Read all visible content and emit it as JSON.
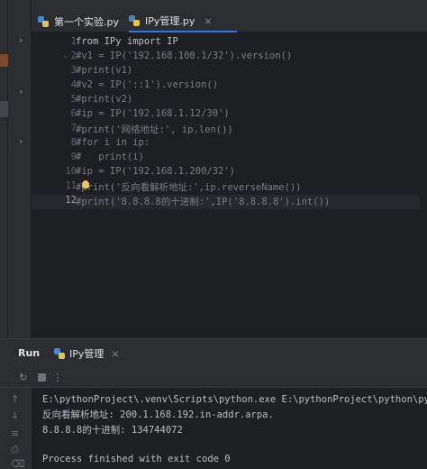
{
  "editor_tabs": [
    {
      "label": "第一个实验.py",
      "active": false
    },
    {
      "label": "IPy管理.py",
      "active": true
    }
  ],
  "tab_close_glyph": "×",
  "project_chevrons": [
    "›",
    "›",
    "›"
  ],
  "code": {
    "current_line": 12,
    "lines": [
      {
        "num": "1",
        "text": "from IPy import IP"
      },
      {
        "num": "2",
        "text": "#v1 = IP('192.168.100.1/32').version()"
      },
      {
        "num": "3",
        "text": "#print(v1)"
      },
      {
        "num": "4",
        "text": "#v2 = IP('::1').version()"
      },
      {
        "num": "5",
        "text": "#print(v2)"
      },
      {
        "num": "6",
        "text": "#ip = IP('192.168.1.12/30')"
      },
      {
        "num": "7",
        "text": "#print('网络地址:', ip.len())"
      },
      {
        "num": "8",
        "text": "#for i in ip:"
      },
      {
        "num": "9",
        "text": "#   print(i)"
      },
      {
        "num": "10",
        "text": "#ip = IP('192.168.1.200/32')"
      },
      {
        "num": "11",
        "text": "#print('反向看解析地址:',ip.reverseName())"
      },
      {
        "num": "12",
        "text": "#print('8.8.8.8的十进制:',IP('8.8.8.8').int())"
      }
    ]
  },
  "run_panel": {
    "title": "Run",
    "tab_label": "IPy管理",
    "console_lines": [
      "E:\\pythonProject\\.venv\\Scripts\\python.exe E:\\pythonProject\\python\\python项",
      "反向看解析地址: 200.1.168.192.in-addr.arpa.",
      "8.8.8.8的十进制: 134744072",
      "",
      "Process finished with exit code 0"
    ]
  },
  "icons": {
    "rerun": "rerun-icon",
    "stop": "stop-icon",
    "more": "more-icon",
    "up": "up-arrow-icon",
    "down": "down-arrow-icon",
    "wrap": "soft-wrap-icon",
    "print": "print-icon",
    "delete": "trash-icon",
    "bulb": "intention-bulb-icon",
    "fold": "fold-icon"
  }
}
